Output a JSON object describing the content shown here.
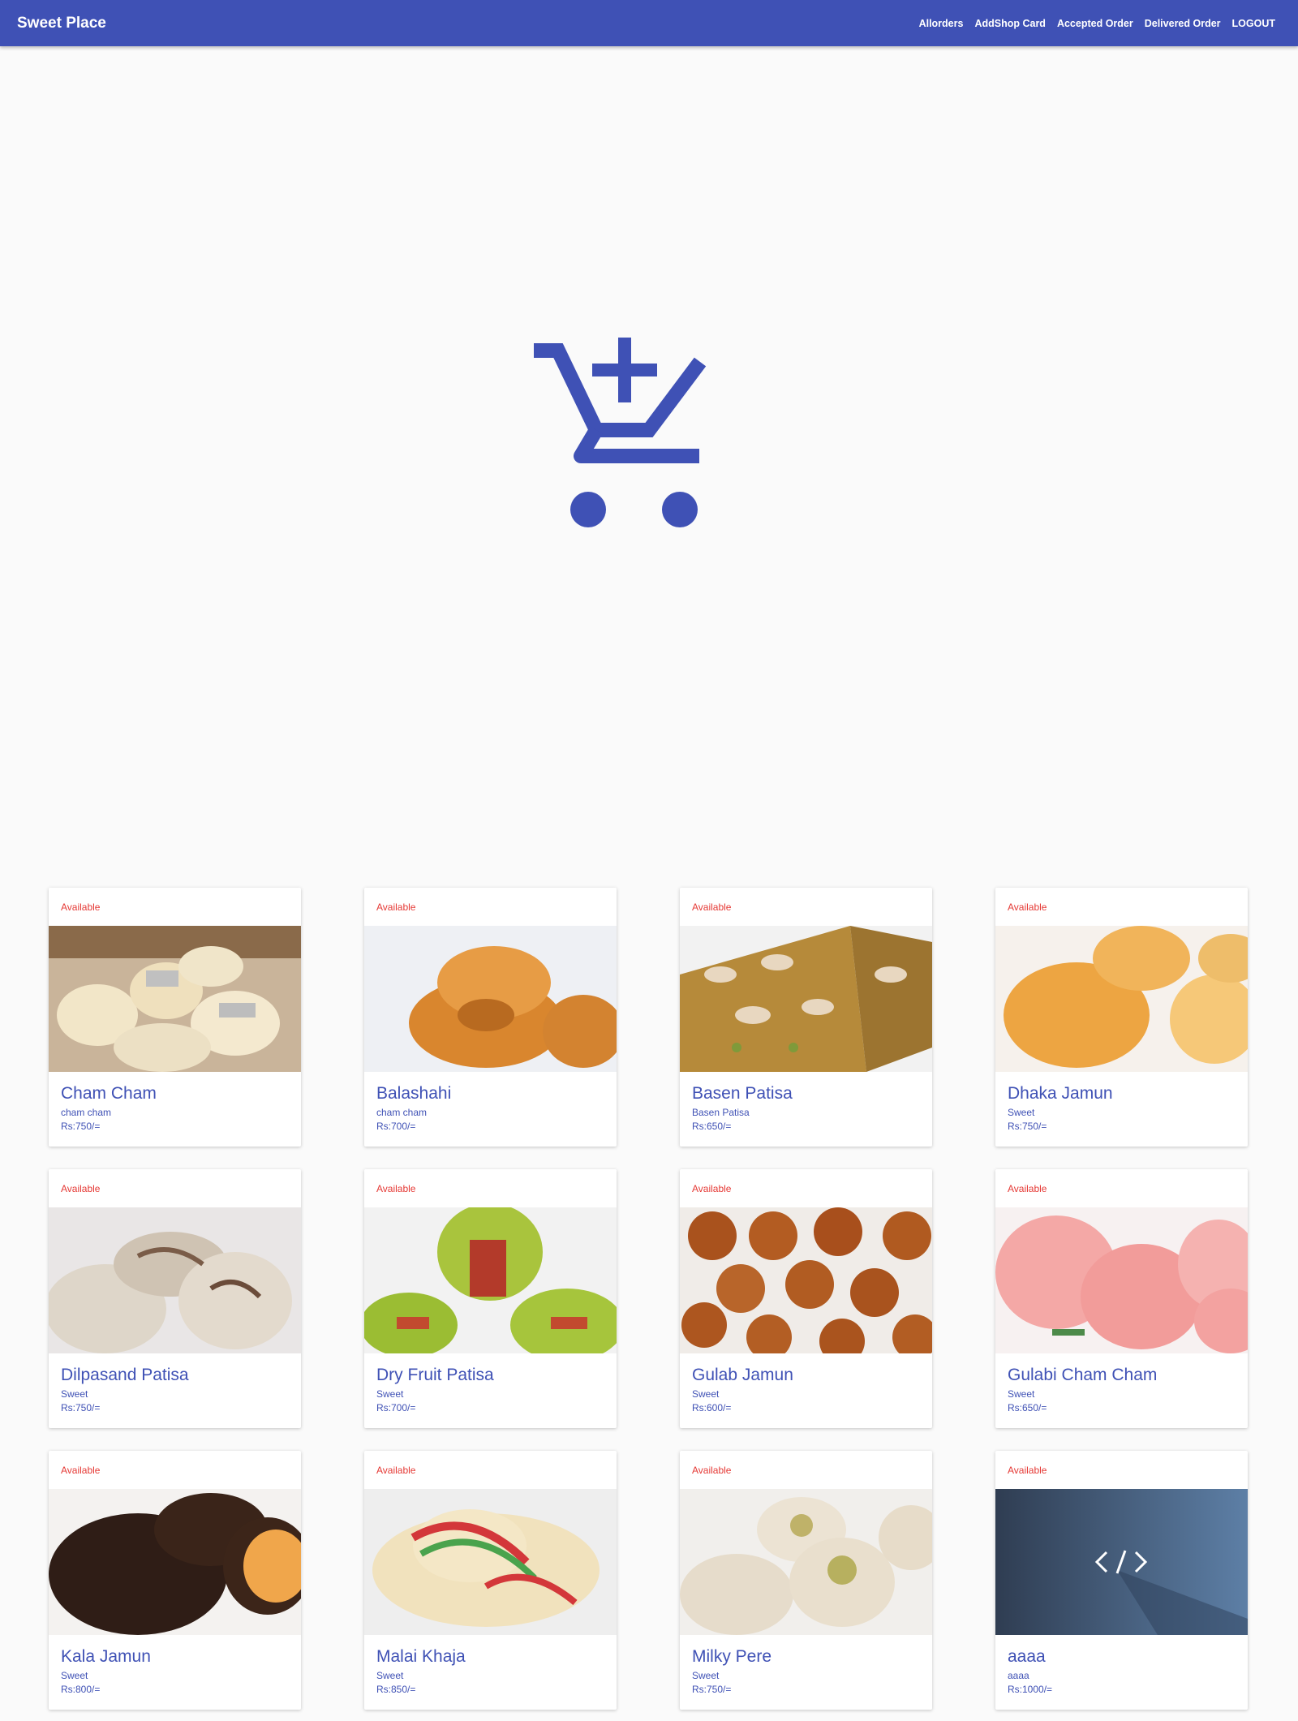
{
  "app": {
    "brand": "Sweet Place"
  },
  "nav": {
    "links": [
      "Allorders",
      "AddShop Card",
      "Accepted Order",
      "Delivered Order",
      "LOGOUT"
    ]
  },
  "hero": {
    "icon": "add-shopping-cart-icon",
    "color": "#3f51b5"
  },
  "colors": {
    "accent": "#3f51b5",
    "status": "#e53935",
    "background": "#fafafa"
  },
  "products": [
    {
      "status": "Available",
      "name": "Cham Cham",
      "desc": "cham cham",
      "price": "Rs:750/=",
      "image": "cham-cham-photo"
    },
    {
      "status": "Available",
      "name": "Balashahi",
      "desc": "cham cham",
      "price": "Rs:700/=",
      "image": "balashahi-photo"
    },
    {
      "status": "Available",
      "name": "Basen Patisa",
      "desc": "Basen Patisa",
      "price": "Rs:650/=",
      "image": "basen-patisa-photo"
    },
    {
      "status": "Available",
      "name": "Dhaka Jamun",
      "desc": "Sweet",
      "price": "Rs:750/=",
      "image": "dhaka-jamun-photo"
    },
    {
      "status": "Available",
      "name": "Dilpasand Patisa",
      "desc": "Sweet",
      "price": "Rs:750/=",
      "image": "dilpasand-patisa-photo"
    },
    {
      "status": "Available",
      "name": "Dry Fruit Patisa",
      "desc": "Sweet",
      "price": "Rs:700/=",
      "image": "dry-fruit-patisa-photo"
    },
    {
      "status": "Available",
      "name": "Gulab Jamun",
      "desc": "Sweet",
      "price": "Rs:600/=",
      "image": "gulab-jamun-photo"
    },
    {
      "status": "Available",
      "name": "Gulabi Cham Cham",
      "desc": "Sweet",
      "price": "Rs:650/=",
      "image": "gulabi-cham-cham-photo"
    },
    {
      "status": "Available",
      "name": "Kala Jamun",
      "desc": "Sweet",
      "price": "Rs:800/=",
      "image": "kala-jamun-photo"
    },
    {
      "status": "Available",
      "name": "Malai Khaja",
      "desc": "Sweet",
      "price": "Rs:850/=",
      "image": "malai-khaja-photo"
    },
    {
      "status": "Available",
      "name": "Milky Pere",
      "desc": "Sweet",
      "price": "Rs:750/=",
      "image": "milky-pere-photo"
    },
    {
      "status": "Available",
      "name": "aaaa",
      "desc": "aaaa",
      "price": "Rs:1000/=",
      "image": "code-placeholder-photo"
    }
  ]
}
